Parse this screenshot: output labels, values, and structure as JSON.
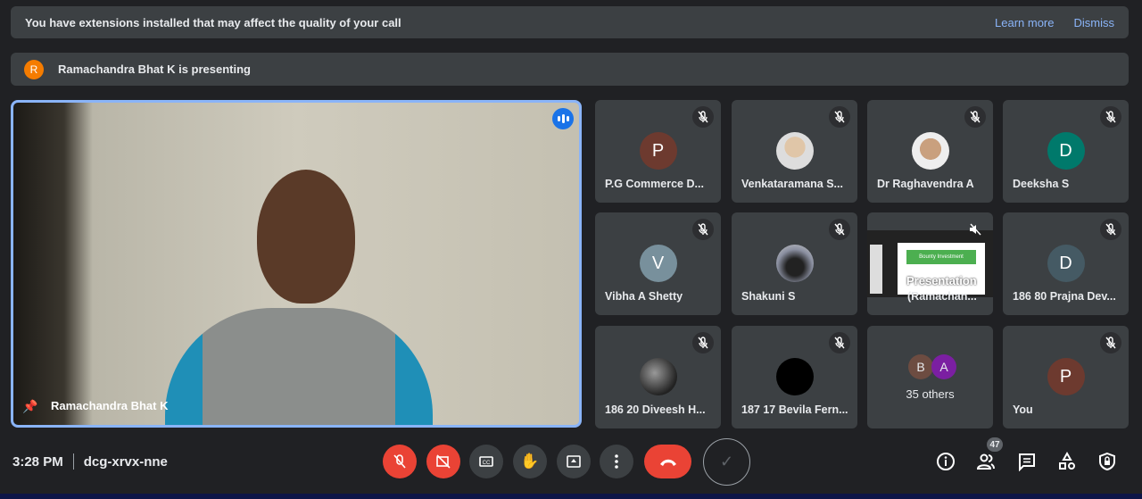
{
  "banner": {
    "message": "You have extensions installed that may affect the quality of your call",
    "learn_more": "Learn more",
    "dismiss": "Dismiss"
  },
  "presenting": {
    "initial": "R",
    "text": "Ramachandra Bhat K is presenting"
  },
  "main_video": {
    "name": "Ramachandra Bhat K"
  },
  "tiles": [
    {
      "name": "P.G Commerce D...",
      "initial": "P",
      "color": "#6d3a2f"
    },
    {
      "name": "Venkataramana S...",
      "photo": true
    },
    {
      "name": "Dr Raghavendra A",
      "photo": true
    },
    {
      "name": "Deeksha S",
      "initial": "D",
      "color": "#00796b"
    },
    {
      "name": "Vibha A Shetty",
      "initial": "V",
      "color": "#78909c"
    },
    {
      "name": "Shakuni S",
      "photo": true
    },
    {
      "name": "(Ramachan...",
      "label": "Presentation",
      "slide_button": "Bounty Investment"
    },
    {
      "name": "186 80 Prajna Dev...",
      "initial": "D",
      "color": "#455a64"
    },
    {
      "name": "186 20 Diveesh H...",
      "photo": true
    },
    {
      "name": "187 17 Bevila Fern...",
      "photo": true
    },
    {
      "name": "35 others",
      "group": [
        "B",
        "A"
      ]
    },
    {
      "name": "You",
      "initial": "P",
      "color": "#6d3a2f"
    }
  ],
  "bottom": {
    "time": "3:28 PM",
    "meeting_code": "dcg-xrvx-nne",
    "participants_count": "47"
  },
  "colors": {
    "accent": "#8ab4f8",
    "danger": "#ea4335",
    "tile": "#3c4043",
    "background": "#202124"
  }
}
